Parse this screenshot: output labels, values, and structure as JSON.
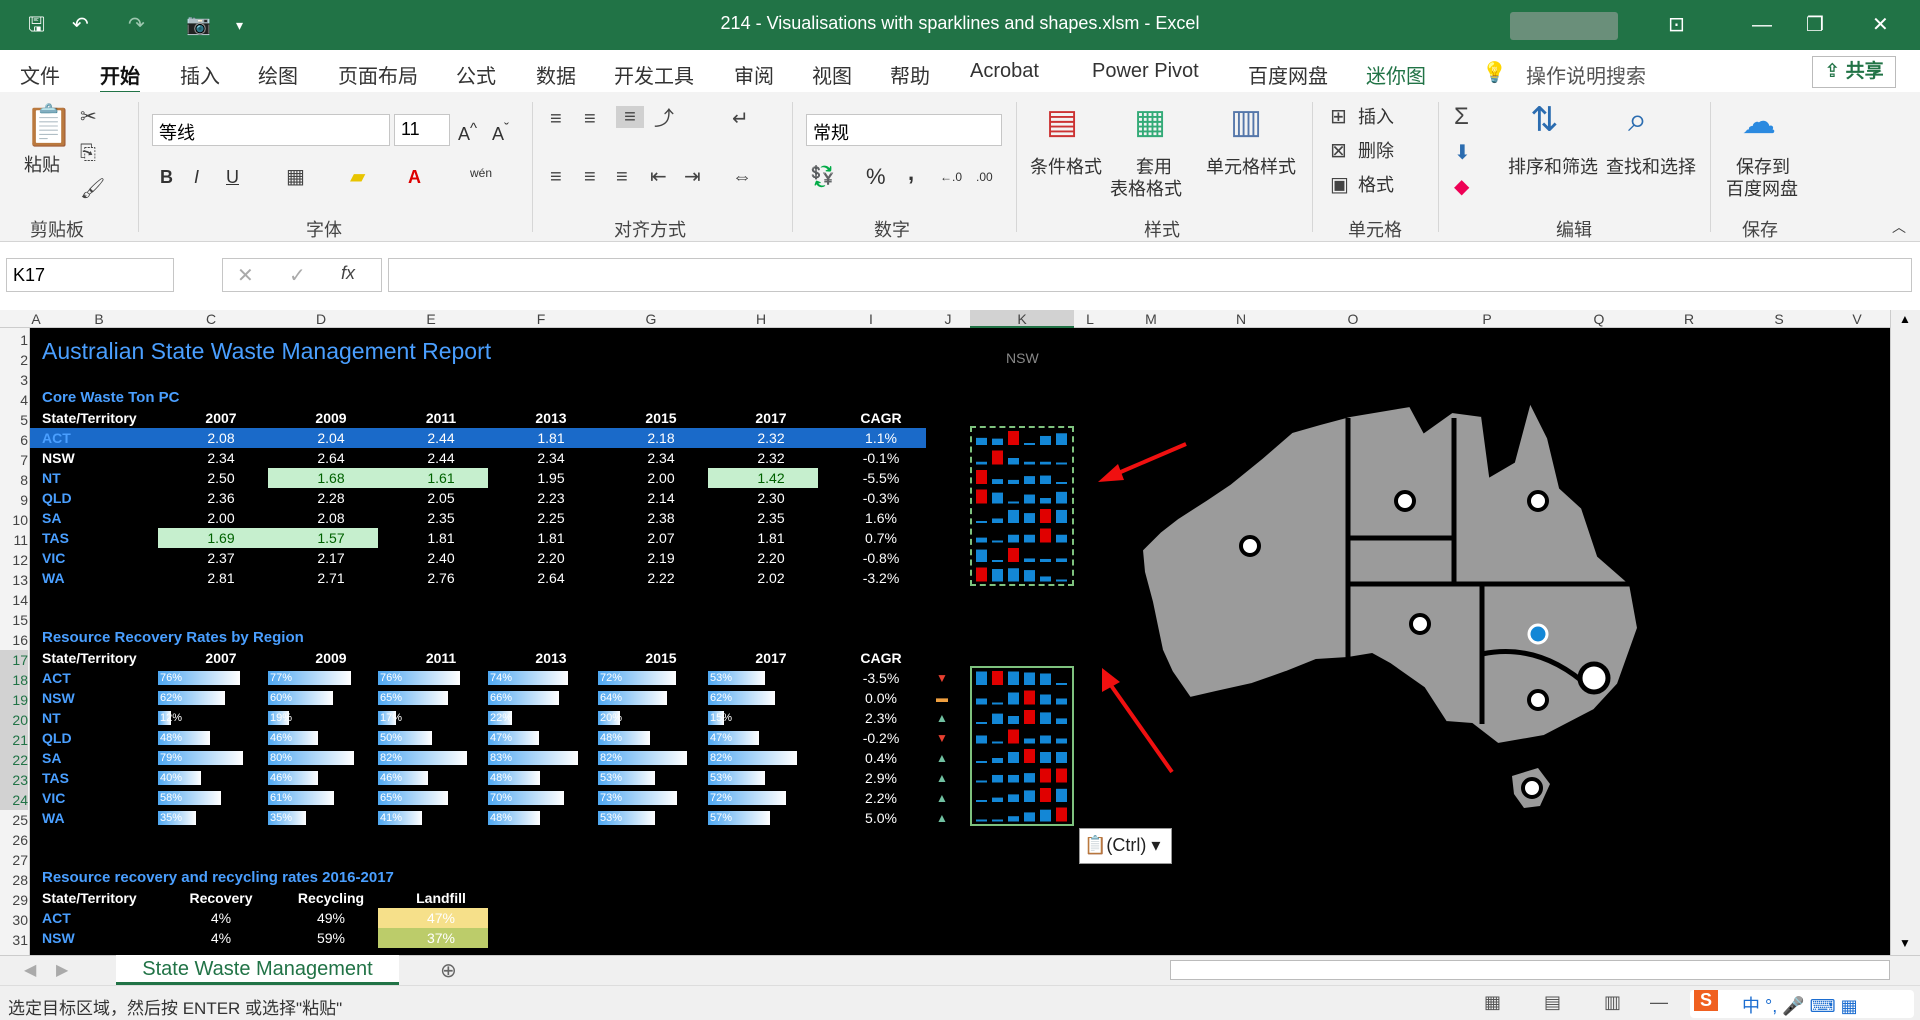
{
  "window": {
    "title": "214 - Visualisations with sparklines and shapes.xlsm  -  Excel"
  },
  "menu": [
    "文件",
    "开始",
    "插入",
    "绘图",
    "页面布局",
    "公式",
    "数据",
    "开发工具",
    "审阅",
    "视图",
    "帮助",
    "Acrobat",
    "Power Pivot",
    "百度网盘",
    "迷你图"
  ],
  "tellme": "操作说明搜索",
  "share": "共享",
  "ribbon": {
    "paste": "粘贴",
    "clipboard": "剪贴板",
    "font_name": "等线",
    "font_size": "11",
    "font": "字体",
    "align": "对齐方式",
    "number_format": "常规",
    "number": "数字",
    "cond_format": "条件格式",
    "table_format1": "套用",
    "table_format2": "表格格式",
    "cell_style": "单元格样式",
    "styles": "样式",
    "insert": "插入",
    "delete": "删除",
    "format": "格式",
    "cells": "单元格",
    "sort_filter": "排序和筛选",
    "find_select": "查找和选择",
    "editing": "编辑",
    "save_baidu1": "保存到",
    "save_baidu2": "百度网盘",
    "save": "保存",
    "bold": "B",
    "italic": "I",
    "underline": "U",
    "wen": "wén",
    "pct": "%",
    "comma": ","
  },
  "name_box": "K17",
  "fx": "fx",
  "columns": [
    "A",
    "B",
    "C",
    "D",
    "E",
    "F",
    "G",
    "H",
    "I",
    "J",
    "K",
    "L",
    "M",
    "N",
    "O",
    "P",
    "Q",
    "R",
    "S",
    "V"
  ],
  "rows": [
    "1",
    "2",
    "3",
    "4",
    "5",
    "6",
    "7",
    "8",
    "9",
    "10",
    "11",
    "12",
    "13",
    "14",
    "15",
    "16",
    "17",
    "18",
    "19",
    "20",
    "21",
    "22",
    "23",
    "24",
    "25",
    "26",
    "27",
    "28",
    "29",
    "30",
    "31"
  ],
  "report": {
    "title": "Australian State Waste Management Report",
    "map_label": "NSW",
    "sec1": "Core Waste Ton PC",
    "sec2": "Resource Recovery Rates by Region",
    "sec3": "Resource recovery and recycling rates 2016-2017",
    "header": [
      "State/Territory",
      "2007",
      "2009",
      "2011",
      "2013",
      "2015",
      "2017",
      "CAGR"
    ],
    "table1": [
      [
        "ACT",
        "2.08",
        "2.04",
        "2.44",
        "1.81",
        "2.18",
        "2.32",
        "1.1%"
      ],
      [
        "NSW",
        "2.34",
        "2.64",
        "2.44",
        "2.34",
        "2.34",
        "2.32",
        "-0.1%"
      ],
      [
        "NT",
        "2.50",
        "1.68",
        "1.61",
        "1.95",
        "2.00",
        "1.42",
        "-5.5%"
      ],
      [
        "QLD",
        "2.36",
        "2.28",
        "2.05",
        "2.23",
        "2.14",
        "2.30",
        "-0.3%"
      ],
      [
        "SA",
        "2.00",
        "2.08",
        "2.35",
        "2.25",
        "2.38",
        "2.35",
        "1.6%"
      ],
      [
        "TAS",
        "1.69",
        "1.57",
        "1.81",
        "1.81",
        "2.07",
        "1.81",
        "0.7%"
      ],
      [
        "VIC",
        "2.37",
        "2.17",
        "2.40",
        "2.20",
        "2.19",
        "2.20",
        "-0.8%"
      ],
      [
        "WA",
        "2.81",
        "2.71",
        "2.76",
        "2.64",
        "2.22",
        "2.02",
        "-3.2%"
      ]
    ],
    "table2": [
      [
        "ACT",
        "76%",
        "77%",
        "76%",
        "74%",
        "72%",
        "53%",
        "-3.5%"
      ],
      [
        "NSW",
        "62%",
        "60%",
        "65%",
        "66%",
        "64%",
        "62%",
        "0.0%"
      ],
      [
        "NT",
        "12%",
        "19%",
        "17%",
        "22%",
        "20%",
        "15%",
        "2.3%"
      ],
      [
        "QLD",
        "48%",
        "46%",
        "50%",
        "47%",
        "48%",
        "47%",
        "-0.2%"
      ],
      [
        "SA",
        "79%",
        "80%",
        "82%",
        "83%",
        "82%",
        "82%",
        "0.4%"
      ],
      [
        "TAS",
        "40%",
        "46%",
        "46%",
        "48%",
        "53%",
        "53%",
        "2.9%"
      ],
      [
        "VIC",
        "58%",
        "61%",
        "65%",
        "70%",
        "73%",
        "72%",
        "2.2%"
      ],
      [
        "WA",
        "35%",
        "35%",
        "41%",
        "48%",
        "53%",
        "57%",
        "5.0%"
      ]
    ],
    "table3_header": [
      "State/Territory",
      "Recovery",
      "Recycling",
      "Landfill"
    ],
    "table3": [
      [
        "ACT",
        "4%",
        "49%",
        "47%"
      ],
      [
        "NSW",
        "4%",
        "59%",
        "37%"
      ]
    ]
  },
  "sheet_tab": "State Waste Management",
  "status": "选定目标区域，然后按 ENTER 或选择\"粘贴\"",
  "paste_options": "(Ctrl)",
  "colors": {
    "excel_green": "#217346",
    "highlight_blue": "#1a6ac9",
    "spark_red": "#e00000",
    "spark_blue": "#1387d6",
    "map_grey": "#9b9b9b"
  }
}
